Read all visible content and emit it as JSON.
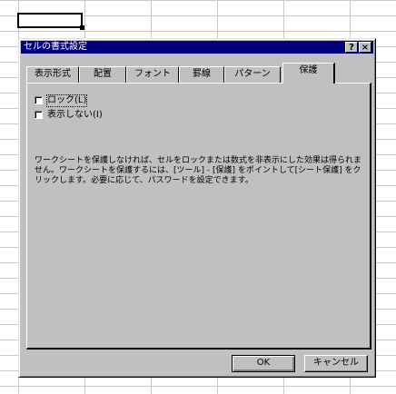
{
  "dialog": {
    "title": "セルの書式設定",
    "help_label": "?",
    "close_label": "×"
  },
  "tabs": [
    {
      "label": "表示形式"
    },
    {
      "label": "配置"
    },
    {
      "label": "フォント"
    },
    {
      "label": "罫線"
    },
    {
      "label": "パターン"
    },
    {
      "label": "保護"
    }
  ],
  "active_tab": "保護",
  "protection": {
    "lock": {
      "label": "ロック(L)",
      "checked": false
    },
    "hidden": {
      "label": "表示しない(I)",
      "checked": false
    },
    "description": "ワークシートを保護しなければ、セルをロックまたは数式を非表示にした効果は得られません。ワークシートを保護するには、[ツール] - [保護] をポイントして[シート保護] をクリックします。必要に応じて、パスワードを設定できます。"
  },
  "buttons": {
    "ok_label": "OK",
    "cancel_label": "キャンセル"
  },
  "colors": {
    "titlebar": "#000080",
    "face": "#c0c0c0"
  }
}
